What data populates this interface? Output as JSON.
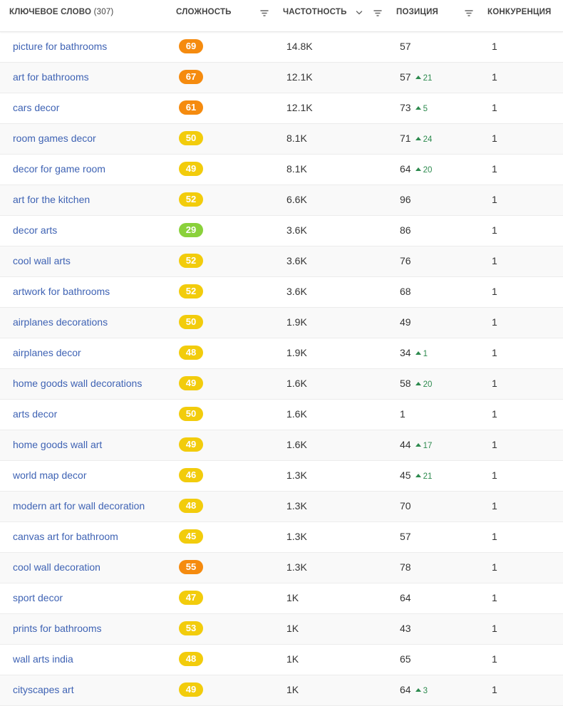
{
  "header": {
    "keyword_label": "Ключевое слово",
    "keyword_count": "(307)",
    "difficulty_label": "Сложность",
    "frequency_label": "Частотность",
    "position_label": "Позиция",
    "competition_label": "Конкуренция"
  },
  "colors": {
    "orange": "#f58b0f",
    "yellow": "#f2cc0c",
    "green": "#8ad13b",
    "link": "#3f63b4",
    "delta_up": "#2d8a4e"
  },
  "rows": [
    {
      "keyword": "picture for bathrooms",
      "difficulty": "69",
      "level": "orange",
      "frequency": "14.8K",
      "position": "57",
      "delta": "",
      "competition": "1"
    },
    {
      "keyword": "art for bathrooms",
      "difficulty": "67",
      "level": "orange",
      "frequency": "12.1K",
      "position": "57",
      "delta": "21",
      "competition": "1"
    },
    {
      "keyword": "cars decor",
      "difficulty": "61",
      "level": "orange",
      "frequency": "12.1K",
      "position": "73",
      "delta": "5",
      "competition": "1"
    },
    {
      "keyword": "room games decor",
      "difficulty": "50",
      "level": "yellow",
      "frequency": "8.1K",
      "position": "71",
      "delta": "24",
      "competition": "1"
    },
    {
      "keyword": "decor for game room",
      "difficulty": "49",
      "level": "yellow",
      "frequency": "8.1K",
      "position": "64",
      "delta": "20",
      "competition": "1"
    },
    {
      "keyword": "art for the kitchen",
      "difficulty": "52",
      "level": "yellow",
      "frequency": "6.6K",
      "position": "96",
      "delta": "",
      "competition": "1"
    },
    {
      "keyword": "decor arts",
      "difficulty": "29",
      "level": "green",
      "frequency": "3.6K",
      "position": "86",
      "delta": "",
      "competition": "1"
    },
    {
      "keyword": "cool wall arts",
      "difficulty": "52",
      "level": "yellow",
      "frequency": "3.6K",
      "position": "76",
      "delta": "",
      "competition": "1"
    },
    {
      "keyword": "artwork for bathrooms",
      "difficulty": "52",
      "level": "yellow",
      "frequency": "3.6K",
      "position": "68",
      "delta": "",
      "competition": "1"
    },
    {
      "keyword": "airplanes decorations",
      "difficulty": "50",
      "level": "yellow",
      "frequency": "1.9K",
      "position": "49",
      "delta": "",
      "competition": "1"
    },
    {
      "keyword": "airplanes decor",
      "difficulty": "48",
      "level": "yellow",
      "frequency": "1.9K",
      "position": "34",
      "delta": "1",
      "competition": "1"
    },
    {
      "keyword": "home goods wall decorations",
      "difficulty": "49",
      "level": "yellow",
      "frequency": "1.6K",
      "position": "58",
      "delta": "20",
      "competition": "1"
    },
    {
      "keyword": "arts decor",
      "difficulty": "50",
      "level": "yellow",
      "frequency": "1.6K",
      "position": "1",
      "delta": "",
      "competition": "1"
    },
    {
      "keyword": "home goods wall art",
      "difficulty": "49",
      "level": "yellow",
      "frequency": "1.6K",
      "position": "44",
      "delta": "17",
      "competition": "1"
    },
    {
      "keyword": "world map decor",
      "difficulty": "46",
      "level": "yellow",
      "frequency": "1.3K",
      "position": "45",
      "delta": "21",
      "competition": "1"
    },
    {
      "keyword": "modern art for wall decoration",
      "difficulty": "48",
      "level": "yellow",
      "frequency": "1.3K",
      "position": "70",
      "delta": "",
      "competition": "1"
    },
    {
      "keyword": "canvas art for bathroom",
      "difficulty": "45",
      "level": "yellow",
      "frequency": "1.3K",
      "position": "57",
      "delta": "",
      "competition": "1"
    },
    {
      "keyword": "cool wall decoration",
      "difficulty": "55",
      "level": "orange",
      "frequency": "1.3K",
      "position": "78",
      "delta": "",
      "competition": "1"
    },
    {
      "keyword": "sport decor",
      "difficulty": "47",
      "level": "yellow",
      "frequency": "1K",
      "position": "64",
      "delta": "",
      "competition": "1"
    },
    {
      "keyword": "prints for bathrooms",
      "difficulty": "53",
      "level": "yellow",
      "frequency": "1K",
      "position": "43",
      "delta": "",
      "competition": "1"
    },
    {
      "keyword": "wall arts india",
      "difficulty": "48",
      "level": "yellow",
      "frequency": "1K",
      "position": "65",
      "delta": "",
      "competition": "1"
    },
    {
      "keyword": "cityscapes art",
      "difficulty": "49",
      "level": "yellow",
      "frequency": "1K",
      "position": "64",
      "delta": "3",
      "competition": "1"
    }
  ]
}
